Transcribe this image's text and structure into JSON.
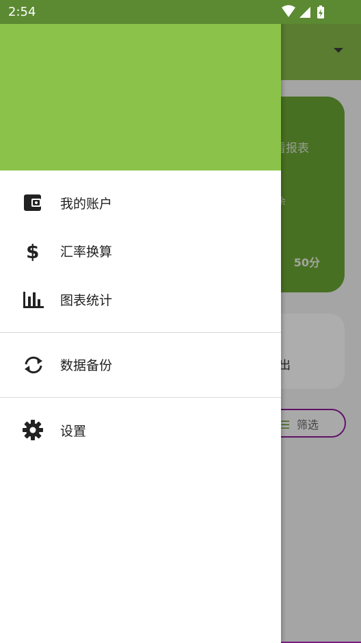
{
  "status_bar": {
    "time": "2:54"
  },
  "background": {
    "card_text_1": "看报表",
    "card_text_2": "余",
    "card_amount": "50分",
    "card2_text": "出",
    "filter_label": "筛选"
  },
  "drawer": {
    "items": [
      {
        "label": "我的账户",
        "icon": "wallet-icon"
      },
      {
        "label": "汇率换算",
        "icon": "dollar-icon"
      },
      {
        "label": "图表统计",
        "icon": "bar-chart-icon"
      },
      {
        "label": "数据备份",
        "icon": "sync-icon"
      },
      {
        "label": "设置",
        "icon": "gear-icon"
      }
    ]
  },
  "colors": {
    "header": "#8bc34a",
    "status_bar": "#5b8a32",
    "accent": "#8e1b9a"
  }
}
